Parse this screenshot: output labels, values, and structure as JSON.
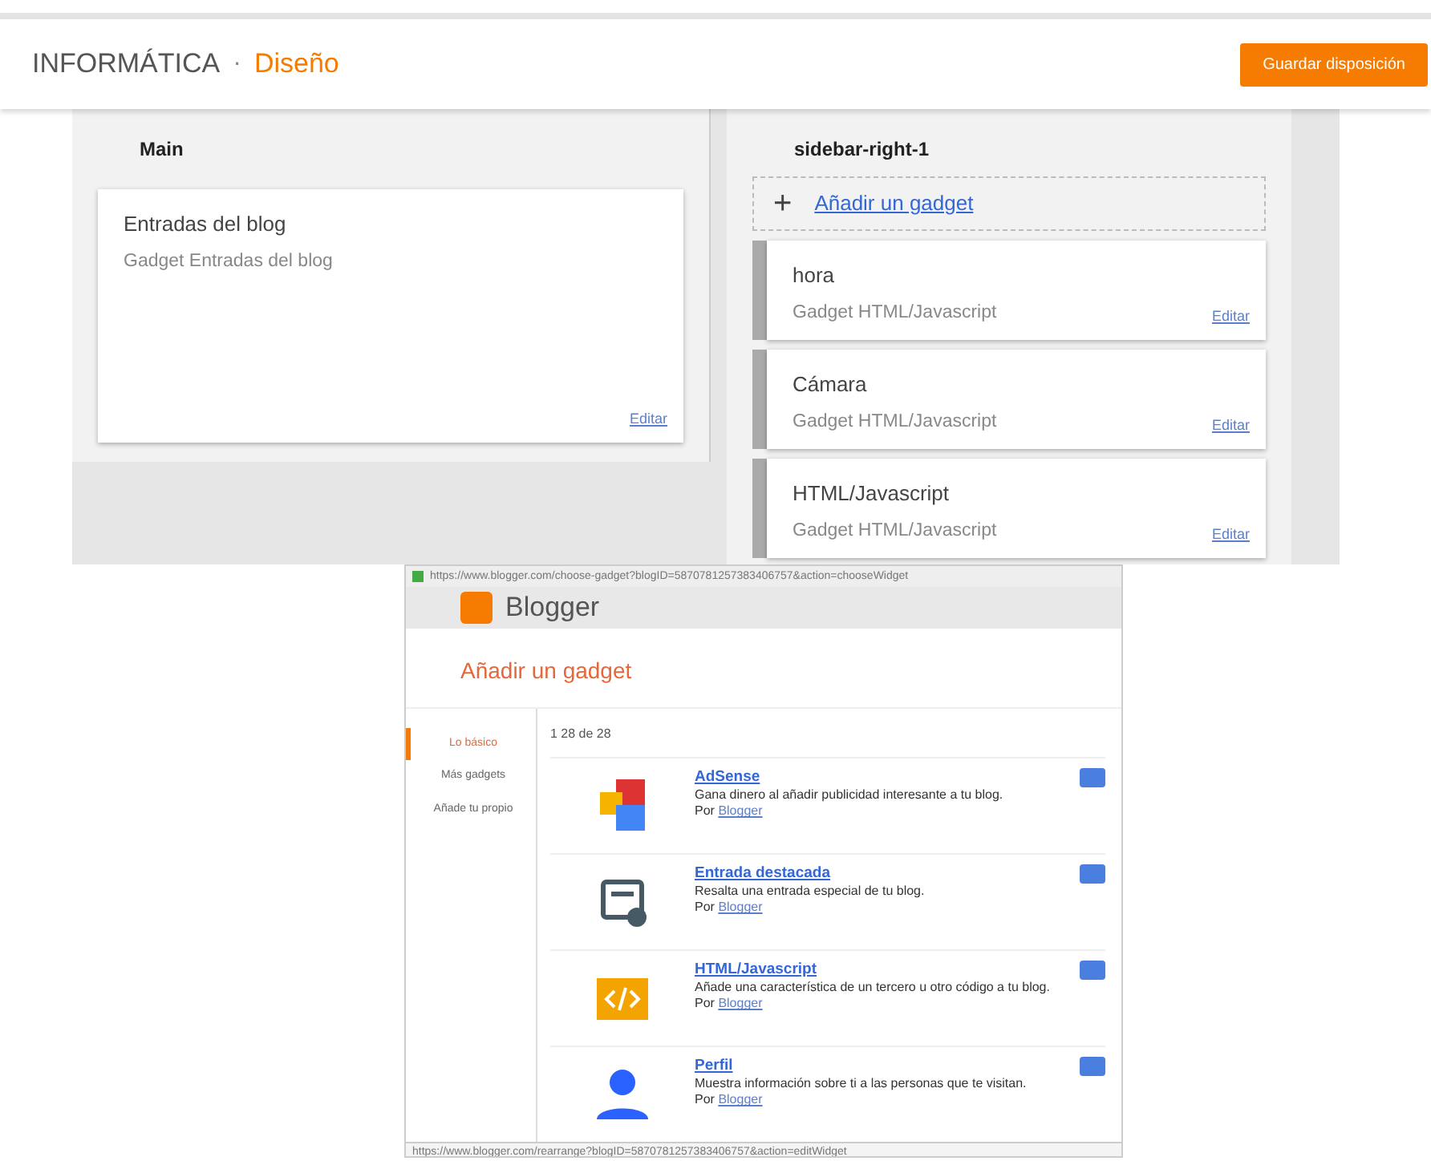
{
  "header": {
    "blog_title": "INFORMÁTICA",
    "separator": "·",
    "page": "Diseño",
    "save_button": "Guardar disposición"
  },
  "main_section": {
    "title": "Main",
    "gadgets": [
      {
        "name": "Entradas del blog",
        "type": "Gadget Entradas del blog",
        "edit": "Editar"
      }
    ]
  },
  "sidebar_section": {
    "title": "sidebar-right-1",
    "add_icon": "+",
    "add_link": "Añadir un gadget",
    "gadgets": [
      {
        "name": "hora",
        "type": "Gadget HTML/Javascript",
        "edit": "Editar"
      },
      {
        "name": "Cámara",
        "type": "Gadget HTML/Javascript",
        "edit": "Editar"
      },
      {
        "name": "HTML/Javascript",
        "type": "Gadget HTML/Javascript",
        "edit": "Editar"
      }
    ]
  },
  "popup": {
    "url": "https://www.blogger.com/choose-gadget?blogID=5870781257383406757&action=chooseWidget",
    "brand": "Blogger",
    "title": "Añadir un gadget",
    "nav": [
      {
        "label": "Lo básico",
        "selected": true
      },
      {
        "label": "Más gadgets",
        "selected": false
      },
      {
        "label": "Añade tu propio",
        "selected": false
      }
    ],
    "count": "1 28 de 28",
    "gadgets": [
      {
        "kind": "adsense",
        "name": "AdSense",
        "description": "Gana dinero al añadir publicidad interesante a tu blog.",
        "by": "Por",
        "author": "Blogger"
      },
      {
        "kind": "featured",
        "name": "Entrada destacada",
        "description": "Resalta una entrada especial de tu blog.",
        "by": "Por",
        "author": "Blogger"
      },
      {
        "kind": "code",
        "name": "HTML/Javascript",
        "description": "Añade una característica de un tercero u otro código a tu blog.",
        "by": "Por",
        "author": "Blogger"
      },
      {
        "kind": "profile",
        "name": "Perfil",
        "description": "Muestra información sobre ti a las personas que te visitan.",
        "by": "Por",
        "author": "Blogger"
      }
    ],
    "status_url": "https://www.blogger.com/rearrange?blogID=5870781257383406757&action=editWidget"
  }
}
